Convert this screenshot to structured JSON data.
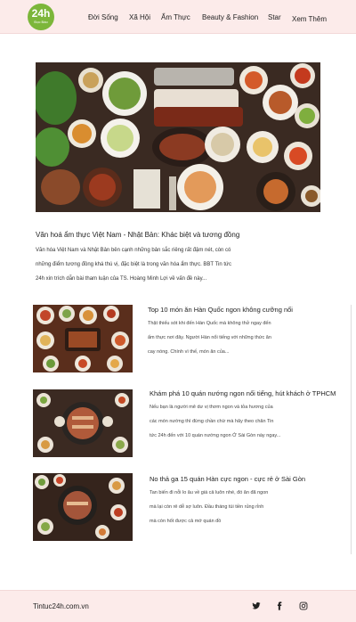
{
  "logo": {
    "main": "24h",
    "sub": "Đọc Báo"
  },
  "nav": [
    "Đời Sống",
    "Xã Hội",
    "Ẩm Thực",
    "Beauty & Fashion",
    "Star",
    "Xem Thêm"
  ],
  "feature": {
    "title": "Văn hoá ẩm thực Việt Nam - Nhật Bản: Khác biệt và tương đồng",
    "lines": [
      "Văn hóa Việt Nam và Nhật Bản bên cạnh những bản sắc riêng rất đậm nét, còn có",
      "những điểm tương đồng khá thú vị, đặc biệt là trong văn hóa ẩm thực. BBT Tin tức",
      "24h xin trích dẫn bài tham luận của TS. Hoàng Minh Lợi về vấn đề này..."
    ]
  },
  "articles": [
    {
      "title": "Top 10 món ăn Hàn Quốc ngon không cưỡng nổi",
      "lines": [
        "Thật thiếu sót khi đến Hàn Quốc mà không thử ngay đến",
        "ẩm thực nơi đây. Người Hàn nổi tiếng với những thức ăn",
        "cay nóng. Chính vì thế, món ăn của..."
      ]
    },
    {
      "title": "Khám phá 10 quán nướng ngon nổi tiếng, hút khách ở TPHCM",
      "lines": [
        "Nếu bạn là người mê dư vị thơm ngon và tỏa hương của",
        "các món nướng thì đừng chần chừ mà hãy theo chân Tin",
        "tức 24h đến với 10 quán nướng ngon Ở Sài Gòn này ngay..."
      ]
    },
    {
      "title": "No thả ga 15 quán Hàn cực ngon - cực rẻ ở Sài Gòn",
      "lines": [
        "Tan biến đi nỗi lo âu về giá cả luôn nhé, đó ăn đã ngon",
        "mà lại còn rẻ dễ sợ luôn. Đầu tháng túi tiền rủng rỉnh",
        "mà còn hốt được cả mớ quán đồ"
      ]
    }
  ],
  "footer": {
    "site": "Tintuc24h.com.vn"
  },
  "social_icons": [
    "twitter-icon",
    "facebook-icon",
    "instagram-icon"
  ],
  "colors": {
    "header_bg": "#fcebea",
    "logo_green": "#7cb63a"
  }
}
